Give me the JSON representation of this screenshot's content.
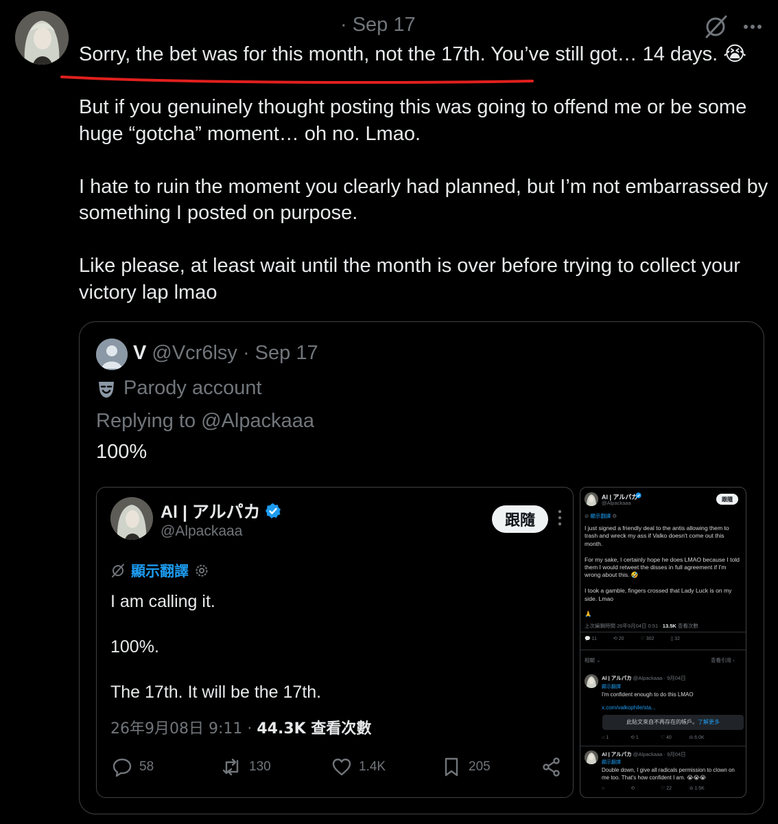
{
  "post": {
    "date_meta": "· Sep 17",
    "paragraphs": [
      "Sorry, the bet was for this month, not the 17th. You’ve still got… 14 days. 😭",
      "But if you genuinely thought posting this was going to offend me or be some huge “gotcha” moment… oh no. Lmao.",
      "I hate to ruin the moment you clearly had planned, but I’m not embarrassed by something I posted on purpose.",
      "Like please, at least wait until the month is over before trying to collect your victory lap lmao"
    ],
    "annotation_color": "#e0201e"
  },
  "quote": {
    "name": "V",
    "meta": " @Vcr6lsy · Sep 17",
    "parody_label": "Parody account",
    "replying_to": "Replying to @Alpackaaa",
    "text": "100%"
  },
  "screenshot_main": {
    "name": "Al | アルパカ",
    "handle": "@Alpackaaa",
    "follow_label": "跟隨",
    "translate_label": "顯示翻譯",
    "body": [
      "I am calling it.",
      "100%.",
      "The 17th. It will be the 17th."
    ],
    "timestamp": "26年9月08日 9:11 · ",
    "views_count": "44.3K",
    "views_label": " 查看次數",
    "replies": "58",
    "reposts": "130",
    "likes": "1.4K",
    "bookmarks": "205",
    "accent_color": "#1d9bf0"
  },
  "screenshot_side": {
    "name": "Al | アルパカ",
    "handle": "@Alpackaaa",
    "follow_label": "跟隨",
    "translate_label": "顯示翻譯",
    "body": [
      "I just signed a friendly deal to the antis allowing them to trash and wreck my ass if Valko doesn't come out this month.",
      "For my sake, I certainly hope he does LMAO because I told them I would retweet the disses in full agreement if I'm wrong about this. 🤣",
      "I took a gamble, fingers crossed that Lady Luck is on my side. Lmao",
      "🙏"
    ],
    "edited_meta": "上次編輯時間 26年9月04日 0:51 · ",
    "views_count": "13.5K",
    "views_label": " 查看次數",
    "stats": [
      "11",
      "20",
      "302",
      "32"
    ],
    "related_label": "相關",
    "quotes_label": "查看引用",
    "reply1": {
      "header": "Al | アルパカ",
      "meta": "@Alpackaaa · 9月04日",
      "translate": "顯示翻譯",
      "text": "I'm confident enough to do this LMAO",
      "link": "x.com/valkophile/sta...",
      "notice": "此貼文來自不再存在的帳戶。",
      "notice_link": "了解更多",
      "stats": [
        "1",
        "1",
        "40",
        "6.0K"
      ]
    },
    "reply2": {
      "header": "Al | アルパカ",
      "meta": "@Alpackaaa · 9月04日",
      "translate": "顯示翻譯",
      "text": "Double down, I give all radicals permission to clown on me too. That's how confident I am. 😭😭😭",
      "stats": [
        "",
        "",
        "22",
        "1.5K"
      ]
    }
  }
}
